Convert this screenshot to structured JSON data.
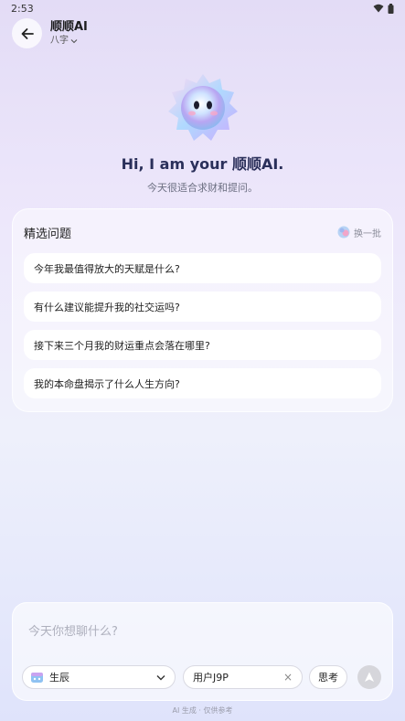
{
  "status_bar": {
    "time": "2:53"
  },
  "header": {
    "title": "顺顺AI",
    "subtitle": "八字"
  },
  "hero": {
    "greeting": "Hi, I am your 顺顺AI.",
    "tagline": "今天很适合求财和提问。"
  },
  "featured": {
    "title": "精选问题",
    "refresh_label": "换一批",
    "questions": [
      "今年我最值得放大的天赋是什么?",
      "有什么建议能提升我的社交运吗?",
      "接下来三个月我的财运重点会落在哪里?",
      "我的本命盘揭示了什么人生方向?"
    ]
  },
  "composer": {
    "placeholder": "今天你想聊什么?",
    "shichen_label": "生辰",
    "user_label": "用户J9P",
    "clear_symbol": "×",
    "think_label": "思考"
  },
  "footer_note": "AI 生成 · 仅供参考",
  "colors": {
    "accent": "#2a2f5a",
    "send_disabled": "#d6d6db"
  }
}
